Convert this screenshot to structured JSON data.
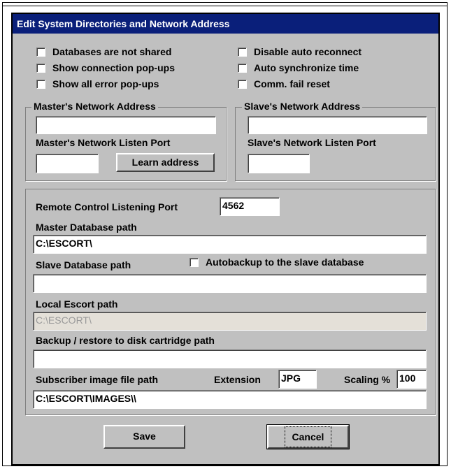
{
  "window": {
    "title": "Edit System Directories and Network Address"
  },
  "options": {
    "databases_not_shared": "Databases are not shared",
    "show_connection_popups": "Show connection pop-ups",
    "show_all_error_popups": "Show all error pop-ups",
    "disable_auto_reconnect": "Disable auto reconnect",
    "auto_synchronize_time": "Auto synchronize time",
    "comm_fail_reset": "Comm. fail reset"
  },
  "master": {
    "group_title": "Master's Network Address",
    "address_value": "",
    "listen_port_label": "Master's Network Listen Port",
    "listen_port_value": "",
    "learn_address_button": "Learn address"
  },
  "slave": {
    "group_title": "Slave's Network Address",
    "address_value": "",
    "listen_port_label": "Slave's Network Listen Port",
    "listen_port_value": ""
  },
  "paths": {
    "remote_port_label": "Remote Control Listening Port",
    "remote_port_value": "4562",
    "master_db_label": "Master Database path",
    "master_db_value": "C:\\ESCORT\\",
    "slave_db_label": "Slave Database path",
    "autobackup_label": "Autobackup to the slave database",
    "slave_db_value": "",
    "local_escort_label": "Local Escort path",
    "local_escort_value": "C:\\ESCORT\\",
    "backup_label": "Backup / restore to disk cartridge path",
    "backup_value": "",
    "subscriber_image_label": "Subscriber image file path",
    "extension_label": "Extension",
    "extension_value": "JPG",
    "scaling_label": "Scaling %",
    "scaling_value": "100",
    "subscriber_image_value": "C:\\ESCORT\\IMAGES\\\\"
  },
  "buttons": {
    "save": "Save",
    "cancel": "Cancel"
  }
}
